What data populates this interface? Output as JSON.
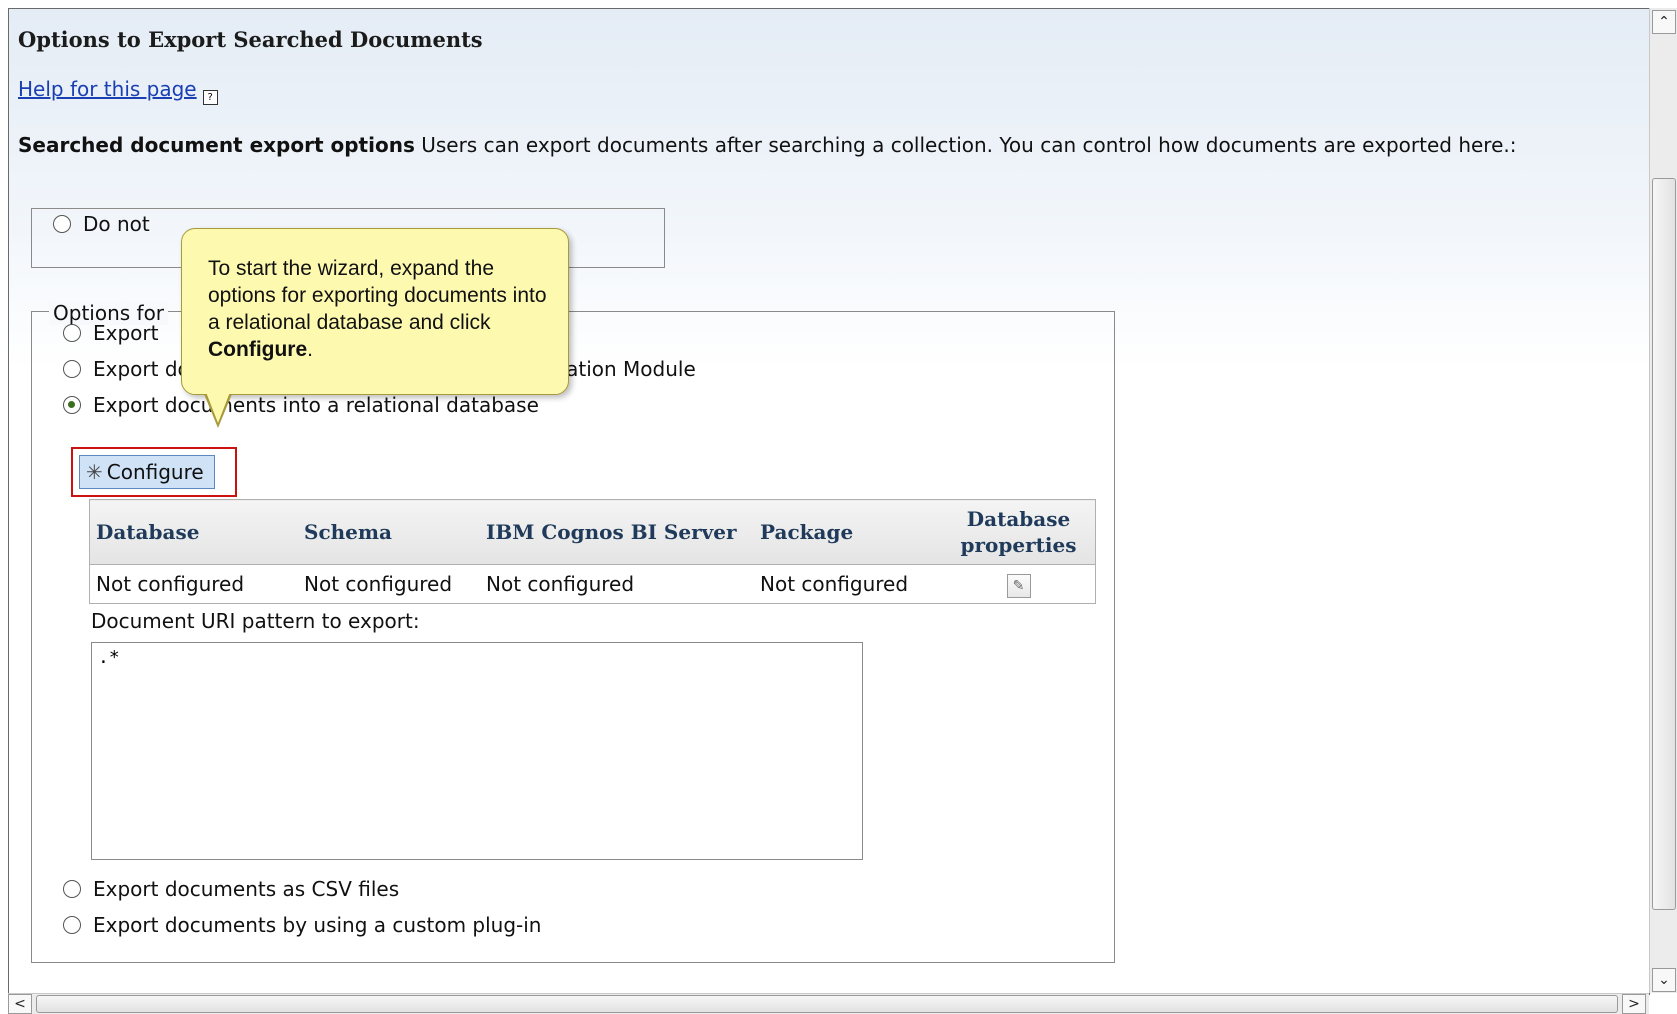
{
  "page": {
    "title": "Options to Export Searched Documents",
    "help_link": "Help for this page",
    "help_icon_glyph": "?",
    "description_bold": "Searched document export options",
    "description_text": " Users can export documents after searching a collection. You can control how documents are exported here.:"
  },
  "do_not_box": {
    "option_label": "Do not"
  },
  "options_group": {
    "legend": "Options for",
    "options": [
      {
        "label": "Export",
        "selected": false
      },
      {
        "label": "Export documents as XML files for IBM Classification Module",
        "selected": false
      },
      {
        "label": "Export documents into a relational database",
        "selected": true
      },
      {
        "label": "Export documents as CSV files",
        "selected": false
      },
      {
        "label": "Export documents by using a custom plug-in",
        "selected": false
      }
    ],
    "configure_button": "Configure",
    "configure_icon": "asterisk-icon"
  },
  "db_table": {
    "headers": [
      "Database",
      "Schema",
      "IBM Cognos BI Server",
      "Package",
      "Database properties"
    ],
    "rows": [
      {
        "database": "Not configured",
        "schema": "Not configured",
        "cognos": "Not configured",
        "package": "Not configured",
        "properties_icon": "pencil-icon"
      }
    ]
  },
  "uri": {
    "label": "Document URI pattern to export:",
    "value": ".*"
  },
  "tooltip": {
    "text": "To start the wizard, expand the options for exporting documents into a relational database and click ",
    "bold": "Configure",
    "end": "."
  },
  "colors": {
    "highlight_border": "#cc1111",
    "tooltip_bg": "#fdfab0",
    "link": "#1a3fb3"
  }
}
